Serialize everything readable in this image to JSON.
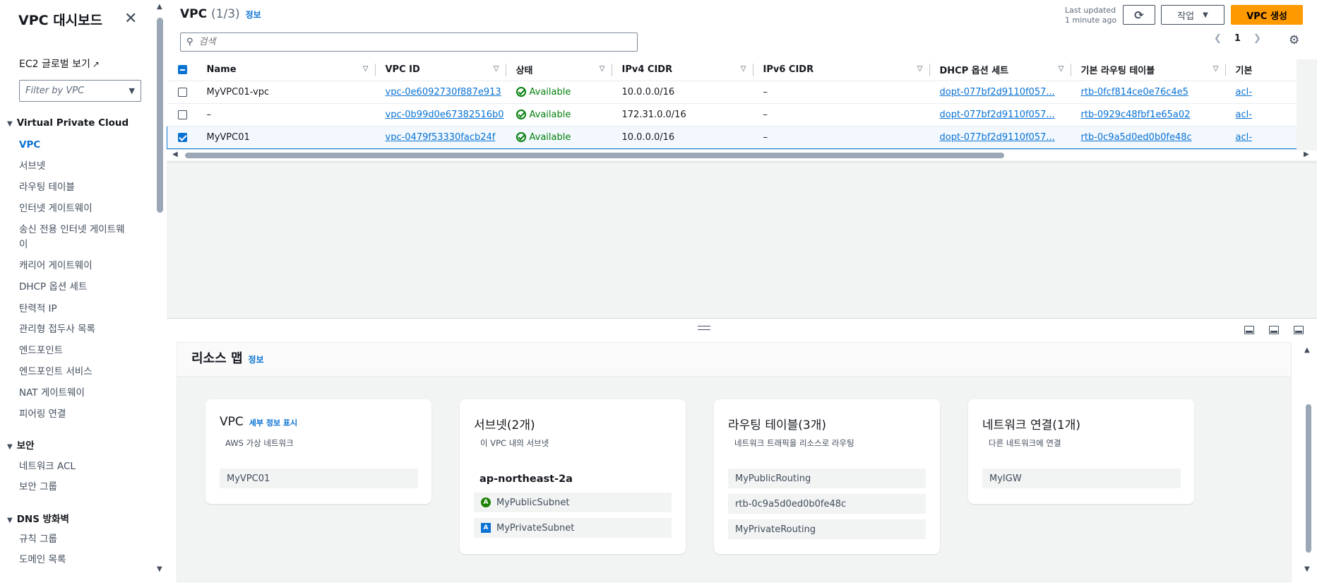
{
  "sidebar": {
    "title": "VPC 대시보드",
    "ec2_link": "EC2 글로벌 보기",
    "filter_placeholder": "Filter by VPC",
    "sections": [
      {
        "label": "Virtual Private Cloud",
        "items": [
          "VPC",
          "서브넷",
          "라우팅 테이블",
          "인터넷 게이트웨이",
          "송신 전용 인터넷 게이트웨이",
          "캐리어 게이트웨이",
          "DHCP 옵션 세트",
          "탄력적 IP",
          "관리형 접두사 목록",
          "엔드포인트",
          "엔드포인트 서비스",
          "NAT 게이트웨이",
          "피어링 연결"
        ]
      },
      {
        "label": "보안",
        "items": [
          "네트워크 ACL",
          "보안 그룹"
        ]
      },
      {
        "label": "DNS 방화벽",
        "items": [
          "규칙 그룹",
          "도메인 목록"
        ]
      }
    ],
    "active_item": "VPC"
  },
  "header": {
    "title": "VPC",
    "count": "(1/3)",
    "info": "정보",
    "last_updated_line1": "Last updated",
    "last_updated_line2": "1 minute ago",
    "action_label": "작업",
    "create_label": "VPC 생성",
    "search_placeholder": "검색",
    "page": "1"
  },
  "table": {
    "columns": [
      "Name",
      "VPC ID",
      "상태",
      "IPv4 CIDR",
      "IPv6 CIDR",
      "DHCP 옵션 세트",
      "기본 라우팅 테이블",
      "기본"
    ],
    "rows": [
      {
        "name": "MyVPC01-vpc",
        "vpc_id": "vpc-0e6092730f887e913",
        "status": "Available",
        "ipv4": "10.0.0.0/16",
        "ipv6": "–",
        "dhcp": "dopt-077bf2d9110f057...",
        "route": "rtb-0fcf814ce0e76c4e5",
        "acl": "acl-",
        "selected": false
      },
      {
        "name": "–",
        "vpc_id": "vpc-0b99d0e67382516b0",
        "status": "Available",
        "ipv4": "172.31.0.0/16",
        "ipv6": "–",
        "dhcp": "dopt-077bf2d9110f057...",
        "route": "rtb-0929c48fbf1e65a02",
        "acl": "acl-",
        "selected": false
      },
      {
        "name": "MyVPC01",
        "vpc_id": "vpc-0479f53330facb24f",
        "status": "Available",
        "ipv4": "10.0.0.0/16",
        "ipv6": "–",
        "dhcp": "dopt-077bf2d9110f057...",
        "route": "rtb-0c9a5d0ed0b0fe48c",
        "acl": "acl-",
        "selected": true
      }
    ]
  },
  "resource_map": {
    "title": "리소스 맵",
    "info": "정보",
    "vpc_card": {
      "title": "VPC",
      "link": "세부 정보 표시",
      "subtitle": "AWS 가상 네트워크",
      "item": "MyVPC01"
    },
    "subnet_card": {
      "title": "서브넷(2개)",
      "subtitle": "이 VPC 내의 서브넷",
      "az": "ap-northeast-2a",
      "items": [
        {
          "badge": "A",
          "label": "MyPublicSubnet"
        },
        {
          "badge": "A",
          "label": "MyPrivateSubnet"
        }
      ]
    },
    "route_card": {
      "title": "라우팅 테이블(3개)",
      "subtitle": "네트워크 트래픽을 리소스로 라우팅",
      "items": [
        "MyPublicRouting",
        "rtb-0c9a5d0ed0b0fe48c",
        "MyPrivateRouting"
      ]
    },
    "network_card": {
      "title": "네트워크 연결(1개)",
      "subtitle": "다른 네트워크에 연결",
      "items": [
        "MyIGW"
      ]
    }
  },
  "colors": {
    "accent": "#0972d3",
    "primary_button": "#ff9900",
    "success": "#037f0c"
  }
}
